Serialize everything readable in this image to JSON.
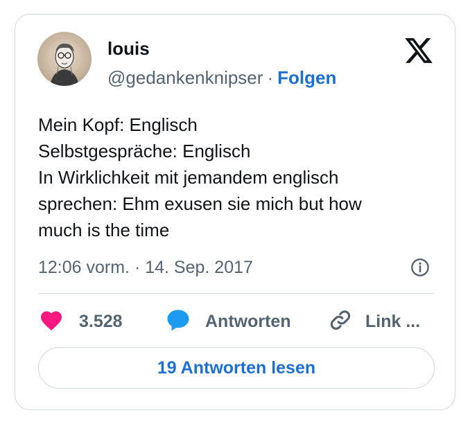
{
  "author": {
    "name": "louis",
    "handle": "@gedankenknipser",
    "separator": "·",
    "follow_label": "Folgen"
  },
  "tweet": {
    "lines": [
      "Mein Kopf: Englisch",
      "Selbstgespräche: Englisch",
      "In Wirklichkeit mit jemandem englisch",
      "sprechen: Ehm exusen sie mich but how",
      "much is the time"
    ],
    "timestamp": "12:06 vorm. · 14. Sep. 2017"
  },
  "actions": {
    "likes": "3.528",
    "reply_label": "Antworten",
    "link_label": "Link ..."
  },
  "read_replies_label": "19 Antworten lesen",
  "icons": {
    "logo": "x-logo-icon",
    "info": "info-icon",
    "like": "heart-icon",
    "reply": "speech-bubble-icon",
    "link": "link-icon"
  },
  "colors": {
    "accent": "#1d6fd1",
    "heart": "#f91880",
    "reply": "#1d9bf0",
    "muted": "#536471",
    "border": "#cfd9de"
  }
}
